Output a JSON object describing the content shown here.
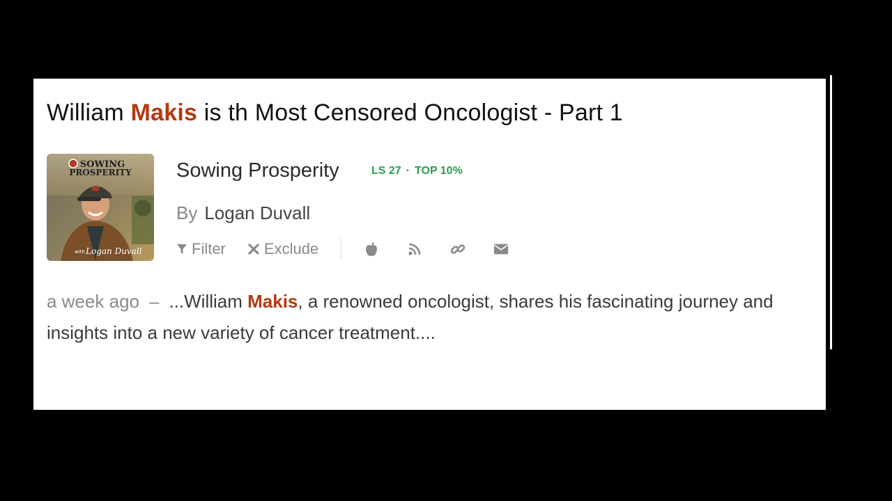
{
  "episode": {
    "title_before": "William ",
    "title_highlight": "Makis",
    "title_after": " is th Most Censored Oncologist - Part 1"
  },
  "podcast": {
    "name": "Sowing Prosperity",
    "listen_score": "LS 27",
    "rank_separator": "·",
    "rank": "TOP 10%",
    "by_label": "By",
    "author": "Logan Duvall",
    "artwork_text": {
      "line1": "SOWING",
      "line2": "PROSPERITY",
      "with": "with",
      "signature": "Logan Duvall"
    }
  },
  "actions": {
    "filter_label": "Filter",
    "exclude_label": "Exclude",
    "icons": [
      "apple-icon",
      "rss-icon",
      "link-icon",
      "mail-icon"
    ]
  },
  "snippet": {
    "time": "a week ago",
    "dash": "–",
    "before": "...William ",
    "highlight": "Makis",
    "after": ", a renowned oncologist, shares his fascinating journey and insights into a new variety of cancer treatment...."
  },
  "colors": {
    "highlight": "#b23a12",
    "rank_green": "#2e9a52",
    "muted_gray": "#8a8a8a"
  }
}
